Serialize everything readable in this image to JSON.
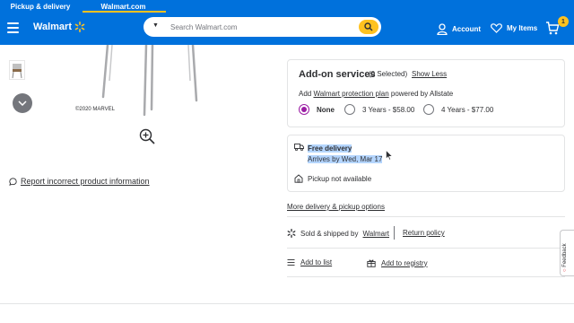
{
  "tabs": [
    {
      "label": "Pickup & delivery"
    },
    {
      "label": "Walmart.com"
    }
  ],
  "header": {
    "logo_text": "Walmart",
    "search_placeholder": "Search Walmart.com",
    "account_label": "Account",
    "my_items_label": "My Items",
    "cart_count": "1",
    "colors": {
      "brand": "#0071dc",
      "accent": "#ffc220"
    }
  },
  "product": {
    "copyright": "©2020 MARVEL",
    "report_link": "Report incorrect product information"
  },
  "addon": {
    "title": "Add-on services",
    "selected_count": "(0 Selected)",
    "show_less": "Show Less",
    "desc_prefix": "Add ",
    "desc_link": "Walmart protection plan",
    "desc_suffix": " powered by Allstate",
    "options": [
      {
        "label": "None",
        "selected": true
      },
      {
        "label": "3 Years - $58.00",
        "selected": false
      },
      {
        "label": "4 Years - $77.00",
        "selected": false
      }
    ],
    "selected_color": "#9b1da4"
  },
  "delivery": {
    "free_label": "Free delivery",
    "arrives": "Arrives by Wed, Mar 17",
    "pickup": "Pickup not available"
  },
  "more_options": "More delivery & pickup options",
  "seller": {
    "prefix": "Sold & shipped by",
    "seller_link": "Walmart",
    "return_policy": "Return policy"
  },
  "actions": {
    "add_to_list": "Add to list",
    "add_to_registry": "Add to registry"
  },
  "feedback": "Feedback"
}
